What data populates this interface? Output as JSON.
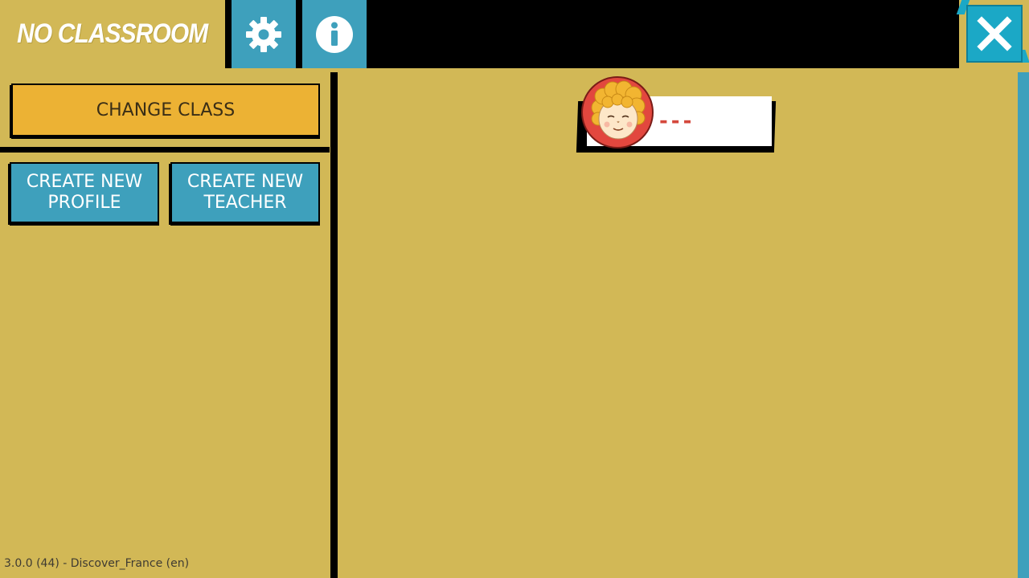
{
  "header": {
    "title": "NO CLASSROOM",
    "settings_icon": "gear-icon",
    "info_icon": "info-icon",
    "close_icon": "close-icon"
  },
  "left_panel": {
    "change_class_label": "CHANGE CLASS",
    "create_profile_label_line1": "CREATE NEW",
    "create_profile_label_line2": "PROFILE",
    "create_teacher_label_line1": "CREATE NEW",
    "create_teacher_label_line2": "TEACHER"
  },
  "profiles": [
    {
      "name": "---",
      "avatar": "child-avatar-icon"
    }
  ],
  "footer": {
    "version": "3.0.0 (44) - Discover_France (en)"
  },
  "colors": {
    "background": "#d2b856",
    "accent_blue": "#3ea0bc",
    "accent_orange": "#ecb234",
    "close_blue": "#1ba8c6",
    "name_red": "#d4483c"
  }
}
